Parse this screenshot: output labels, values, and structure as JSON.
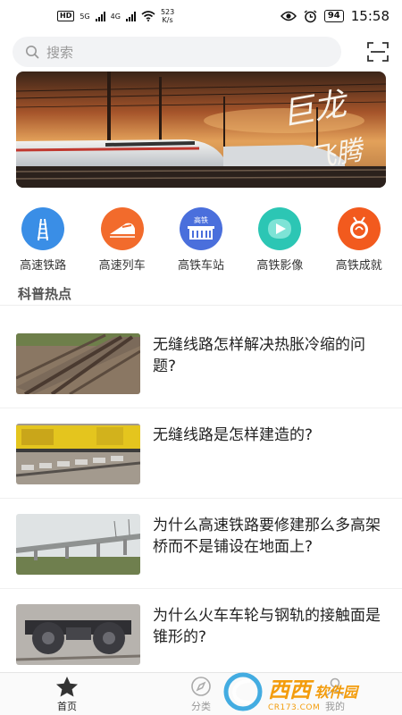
{
  "status_bar": {
    "hd": "HD",
    "network1": "5G",
    "network2": "4G",
    "speed_value": "523",
    "speed_unit": "K/s",
    "battery": "94",
    "time": "15:58"
  },
  "search": {
    "placeholder": "搜索"
  },
  "banner": {
    "calligraphy_line1": "巨龙",
    "calligraphy_line2": "飞腾"
  },
  "categories": [
    {
      "label": "高速铁路",
      "color": "#3a8ee6"
    },
    {
      "label": "高速列车",
      "color": "#f26b2c"
    },
    {
      "label": "高铁车站",
      "color": "#4a6fdc",
      "badge": "高铁"
    },
    {
      "label": "高铁影像",
      "color": "#2cc6b4"
    },
    {
      "label": "高铁成就",
      "color": "#f25a1e"
    }
  ],
  "section": {
    "title": "科普热点"
  },
  "articles": [
    {
      "title": "无缝线路怎样解决热胀冷缩的问题?"
    },
    {
      "title": "无缝线路是怎样建造的?"
    },
    {
      "title": "为什么高速铁路要修建那么多高架桥而不是铺设在地面上?"
    },
    {
      "title": "为什么火车车轮与钢轨的接触面是锥形的?"
    }
  ],
  "tabbar": {
    "home": "首页",
    "category": "分类",
    "mine": "我的"
  },
  "watermark": {
    "brand": "西西",
    "name": "软件园",
    "url": "CR173.COM"
  }
}
